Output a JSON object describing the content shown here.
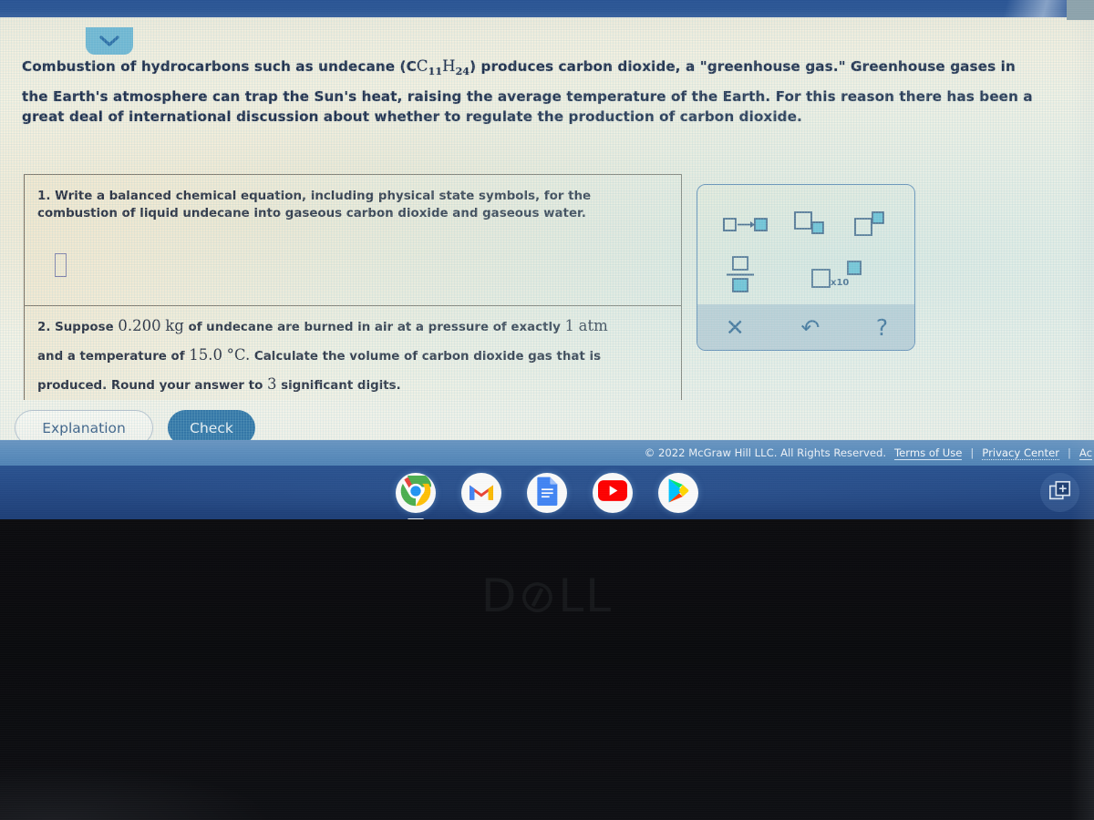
{
  "browser": {
    "collapse_tab_icon": "chevron-down-icon"
  },
  "intro": {
    "line1_a": "Combustion of hydrocarbons such as undecane (C",
    "line1_sub1": "11",
    "line1_b": "H",
    "line1_sub2": "24",
    "line1_c": ") produces carbon dioxide, a \"greenhouse gas.\" Greenhouse gases in",
    "line2": "the Earth's atmosphere can trap the Sun's heat, raising the average temperature of the Earth. For this reason there has been a",
    "line3": "great deal of international discussion about whether to regulate the production of carbon dioxide."
  },
  "question1": {
    "number": "1.",
    "text": "Write a balanced chemical equation, including physical state symbols, for the combustion of liquid undecane into gaseous carbon dioxide and gaseous water.",
    "answer_value": ""
  },
  "question2": {
    "line1_a": "2. Suppose",
    "line1_val": "0.200",
    "line1_unit": "kg",
    "line1_b": "of undecane are burned in air at a pressure of exactly",
    "line1_val2": "1",
    "line1_unit2": "atm",
    "line2_a": "and a temperature of",
    "line2_val": "15.0",
    "line2_unit": "°C.",
    "line2_b": "Calculate the volume of carbon dioxide gas that is",
    "line3_a": "produced. Round your answer to",
    "line3_val": "3",
    "line3_b": "significant digits."
  },
  "keypad": {
    "buttons": [
      {
        "name": "reaction-arrow-icon",
        "label": "□→□"
      },
      {
        "name": "subscript-icon",
        "label": "□□"
      },
      {
        "name": "superscript-icon",
        "label": "□□"
      },
      {
        "name": "fraction-icon",
        "label": "□/□"
      },
      {
        "name": "scientific-notation-icon",
        "label": "□ x10 □"
      }
    ],
    "footer_buttons": [
      {
        "name": "clear-icon",
        "label": "✕"
      },
      {
        "name": "undo-icon",
        "label": "↺"
      },
      {
        "name": "help-icon",
        "label": "?"
      }
    ],
    "scientific_notation_label": "x10"
  },
  "actions": {
    "explanation_label": "Explanation",
    "check_label": "Check"
  },
  "footer": {
    "copyright": "© 2022 McGraw Hill LLC. All Rights Reserved.",
    "terms_label": "Terms of Use",
    "privacy_label": "Privacy Center",
    "accessibility_label": "Ac",
    "separator": "|"
  },
  "taskbar": {
    "launchers": [
      {
        "name": "chrome-icon",
        "label": "Chrome"
      },
      {
        "name": "gmail-icon",
        "label": "Gmail"
      },
      {
        "name": "google-docs-icon",
        "label": "Docs"
      },
      {
        "name": "youtube-icon",
        "label": "YouTube"
      },
      {
        "name": "play-store-icon",
        "label": "Play Store"
      }
    ],
    "tray_icon": "screen-capture-icon"
  },
  "device": {
    "brand_d": "D",
    "brand_o": "⊘",
    "brand_ll": "LL"
  },
  "colors": {
    "accent_blue": "#3277a8",
    "page_cream": "#f6f4e6",
    "taskbar_blue": "#254a86",
    "footer_blue": "#5e8fbe",
    "keypad_blue": "#5d87b4",
    "math_teal": "#5bc0d8"
  }
}
